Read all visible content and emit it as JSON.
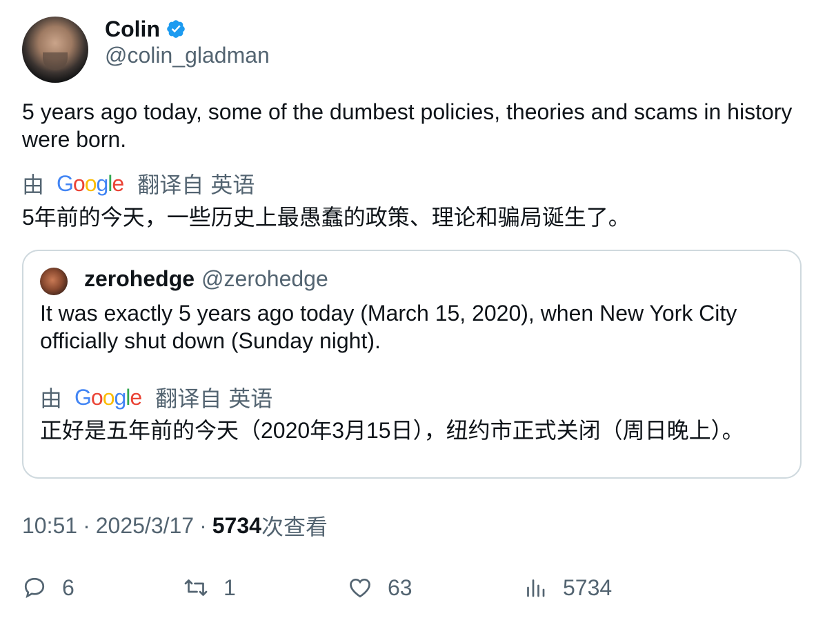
{
  "author": {
    "name": "Colin",
    "handle": "@colin_gladman",
    "verified_color": "#1d9bf0"
  },
  "tweet_text": "5 years ago today, some of the dumbest policies, theories and scams in history were born.",
  "translation": {
    "by": "由",
    "google": [
      "G",
      "o",
      "o",
      "g",
      "l",
      "e"
    ],
    "translated_from": "翻译自",
    "source_lang": "英语",
    "text": "5年前的今天，一些历史上最愚蠢的政策、理论和骗局诞生了。"
  },
  "quote": {
    "name": "zerohedge",
    "handle": "@zerohedge",
    "text": "It was exactly 5 years ago today (March 15, 2020), when New York City officially shut down (Sunday night).",
    "translation": {
      "by": "由",
      "translated_from": "翻译自",
      "source_lang": "英语",
      "text": "正好是五年前的今天（2020年3月15日），纽约市正式关闭（周日晚上）。"
    }
  },
  "meta": {
    "time": "10:51",
    "sep": "·",
    "date": "2025/3/17",
    "views": "5734",
    "views_label": "次查看"
  },
  "actions": {
    "replies": "6",
    "retweets": "1",
    "likes": "63",
    "views": "5734"
  }
}
